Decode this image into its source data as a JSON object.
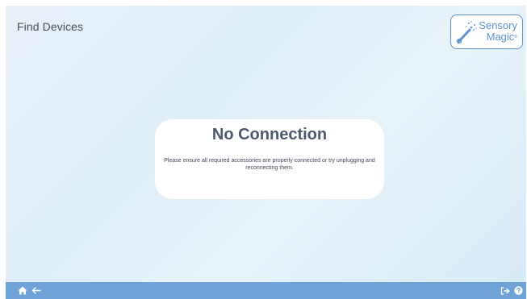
{
  "header": {
    "title": "Find Devices"
  },
  "logo": {
    "line1": "Sensory",
    "line2": "Magic",
    "reg": "®"
  },
  "dialog": {
    "title": "No Connection",
    "message": "Please ensure all required accessories are properly connected or try unplugging and reconnecting them."
  },
  "bottom_bar": {
    "left_icons": [
      "home-icon",
      "back-arrow-icon"
    ],
    "right_icons": [
      "logout-icon",
      "help-icon"
    ]
  },
  "colors": {
    "bar": "#6fa3d8",
    "brand": "#5c93cc",
    "title_text": "#4d5a6e"
  }
}
